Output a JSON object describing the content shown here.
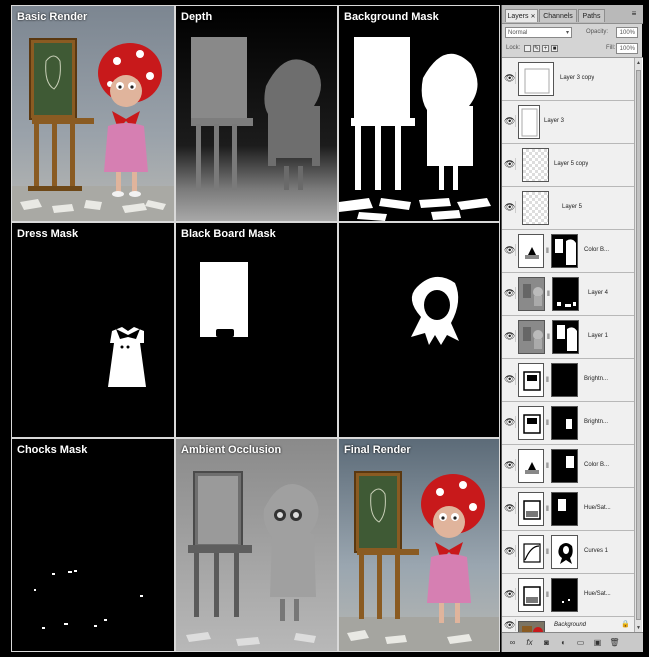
{
  "passes": {
    "basic": "Basic Render",
    "depth": "Depth",
    "bgmask": "Background Mask",
    "dress": "Dress Mask",
    "board": "Black Board  Mask",
    "scarf": "",
    "chocks": "Chocks Mask",
    "ao": "Ambient Occlusion",
    "final": "Final Render"
  },
  "panel": {
    "tabs": [
      "Layers",
      "Channels",
      "Paths"
    ],
    "blend_mode": "Normal",
    "opacity_label": "Opacity:",
    "opacity_value": "100%",
    "lock_label": "Lock:",
    "fill_label": "Fill:",
    "fill_value": "100%",
    "layers": [
      {
        "name": "Layer 3 copy"
      },
      {
        "name": "Layer 3"
      },
      {
        "name": "Layer 5 copy"
      },
      {
        "name": "Layer 5"
      },
      {
        "name": "Color B..."
      },
      {
        "name": "Layer 4"
      },
      {
        "name": "Layer 1"
      },
      {
        "name": "Brightn..."
      },
      {
        "name": "Brightn..."
      },
      {
        "name": "Color B..."
      },
      {
        "name": "Hue/Sat..."
      },
      {
        "name": "Curves 1"
      },
      {
        "name": "Hue/Sat..."
      },
      {
        "name": "Background"
      }
    ]
  },
  "icons": {
    "eye": "eye-icon",
    "link": "link-icon",
    "fx": "fx-icon",
    "mask": "add-mask-icon",
    "adjust": "adjustment-layer-icon",
    "group": "new-group-icon",
    "newlayer": "new-layer-icon",
    "trash": "trash-icon",
    "menu": "panel-menu-icon",
    "lock": "lock-icon"
  }
}
